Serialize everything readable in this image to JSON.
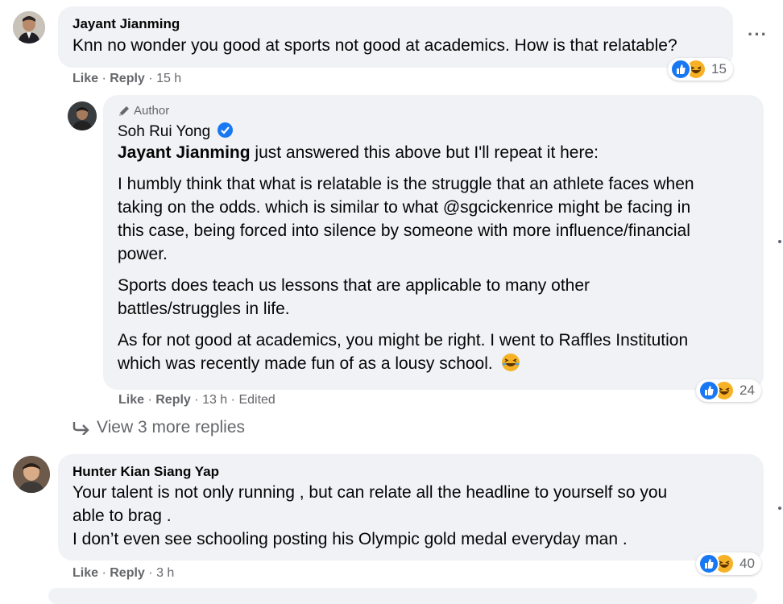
{
  "comments": [
    {
      "author": "Jayant Jianming",
      "text": "Knn no wonder you good at sports not good at academics. How is that relatable?",
      "actions": {
        "like": "Like",
        "reply": "Reply",
        "time": "15 h"
      },
      "reaction_count": "15"
    },
    {
      "badge": "Author",
      "author": "Soh Rui Yong",
      "mention": "Jayant Jianming",
      "first_line_rest": " just answered this above but I'll repeat it here:",
      "paragraph_2_line_1": "I humbly think that what is relatable is the struggle that an athlete faces when",
      "paragraph_2_line_2": "taking on the odds. which is similar to what @sgcickenrice might be facing in",
      "paragraph_2_line_3": "this case, being forced into silence by someone with more influence/financial",
      "paragraph_2_line_4": "power.",
      "paragraph_3_line_1": "Sports does teach us lessons that are applicable to many other",
      "paragraph_3_line_2": "battles/struggles in life.",
      "paragraph_4_line_1": "As for not good at academics, you might be right. I went to Raffles Institution",
      "paragraph_4_line_2": "which was recently made fun of as a lousy school.",
      "actions": {
        "like": "Like",
        "reply": "Reply",
        "time": "13 h",
        "edited": "Edited"
      },
      "reaction_count": "24"
    },
    {
      "author": "Hunter Kian Siang Yap",
      "line_1": "Your talent is not only running , but can relate all the headline to yourself so you",
      "line_2": "able to brag .",
      "line_3": "I don’t even see schooling posting his Olympic gold medal everyday man .",
      "actions": {
        "like": "Like",
        "reply": "Reply",
        "time": "3 h"
      },
      "reaction_count": "40"
    }
  ],
  "view_more": "View 3 more replies",
  "icons": {
    "more": "more-options-icon",
    "reply_arrow": "reply-arrow-icon",
    "author_badge": "pencil-icon",
    "verified": "verified-badge-icon",
    "like": "like-reaction-icon",
    "haha": "haha-reaction-icon",
    "laugh_emoji": "laughing-emoji-icon"
  },
  "colors": {
    "bubble": "#f0f2f5",
    "secondary_text": "#65676b",
    "like_blue": "#1877f2",
    "haha_yellow": "#f7b125"
  }
}
